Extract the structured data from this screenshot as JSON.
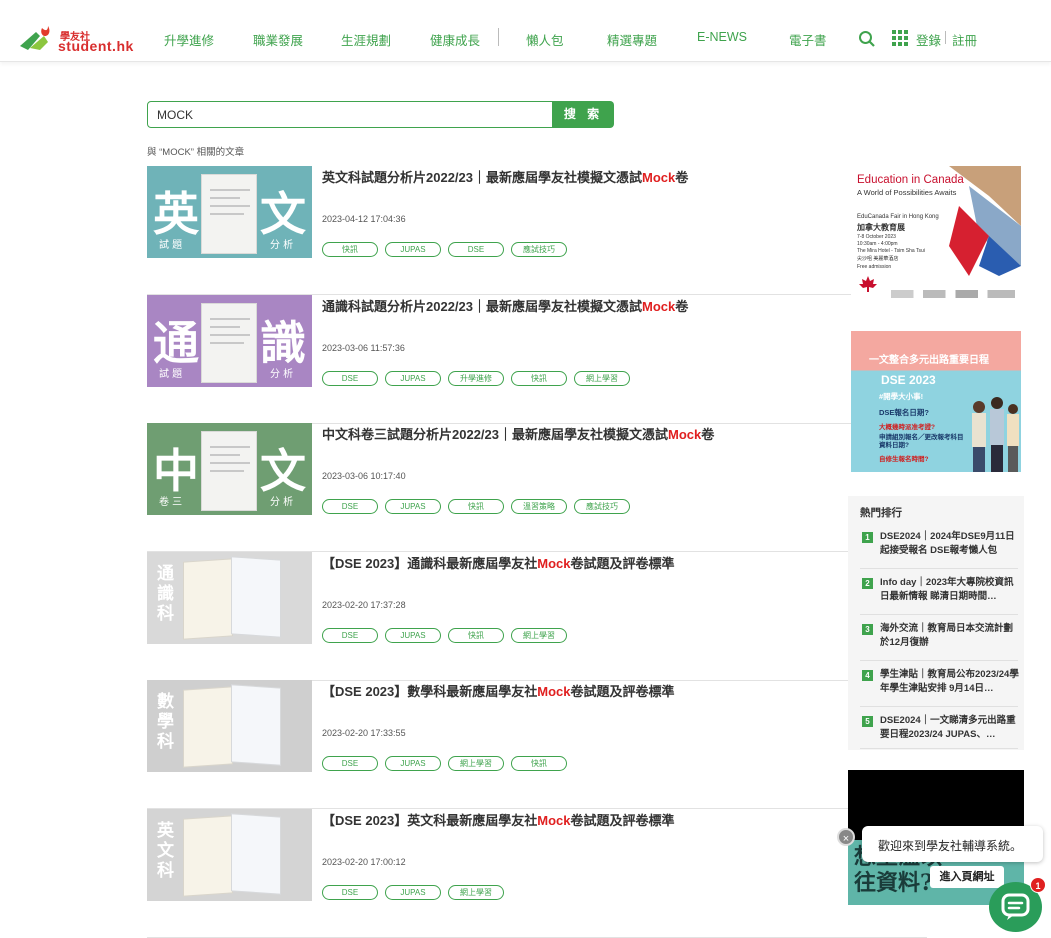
{
  "header": {
    "logo_cn": "學友社",
    "logo_en": "student.hk",
    "nav": [
      "升學進修",
      "職業發展",
      "生涯規劃",
      "健康成長",
      "懶人包",
      "精選專題",
      "E-NEWS",
      "電子書"
    ],
    "login": "登錄",
    "register": "註冊"
  },
  "search": {
    "value": "MOCK",
    "button": "搜 索",
    "result_label": "與 “MOCK” 相關的文章"
  },
  "articles": [
    {
      "title_pre": "英文科試題分析片2022/23｜最新應屆學友社模擬文憑試",
      "title_hl": "Mock",
      "title_post": "卷",
      "date": "2023-04-12 17:04:36",
      "tags": [
        "快訊",
        "JUPAS",
        "DSE",
        "應試技巧"
      ],
      "thumb_left": "英",
      "thumb_right": "文",
      "thumb_sub_left": "試 題",
      "thumb_sub_right": "分 析",
      "thumb_color": "#6fb3b8"
    },
    {
      "title_pre": "通識科試題分析片2022/23｜最新應屆學友社模擬文憑試",
      "title_hl": "Mock",
      "title_post": "卷",
      "date": "2023-03-06 11:57:36",
      "tags": [
        "DSE",
        "JUPAS",
        "升學進修",
        "快訊",
        "網上學習"
      ],
      "thumb_left": "通",
      "thumb_right": "識",
      "thumb_sub_left": "試 題",
      "thumb_sub_right": "分 析",
      "thumb_color": "#a986c3"
    },
    {
      "title_pre": "中文科卷三試題分析片2022/23｜最新應屆學友社模擬文憑試",
      "title_hl": "Mock",
      "title_post": "卷",
      "date": "2023-03-06 10:17:40",
      "tags": [
        "DSE",
        "JUPAS",
        "快訊",
        "溫習策略",
        "應試技巧"
      ],
      "thumb_left": "中",
      "thumb_right": "文",
      "thumb_sub_left": "卷 三",
      "thumb_sub_right": "分 析",
      "thumb_color": "#6f9e72"
    },
    {
      "title_pre": "【DSE 2023】通識科最新應屆學友社",
      "title_hl": "Mock",
      "title_post": "卷試題及評卷標準",
      "date": "2023-02-20 17:37:28",
      "tags": [
        "DSE",
        "JUPAS",
        "快訊",
        "網上學習"
      ],
      "thumb_vert": "通識科",
      "thumb_color": "#d9d9d9"
    },
    {
      "title_pre": "【DSE 2023】數學科最新應屆學友社",
      "title_hl": "Mock",
      "title_post": "卷試題及評卷標準",
      "date": "2023-02-20 17:33:55",
      "tags": [
        "DSE",
        "JUPAS",
        "網上學習",
        "快訊"
      ],
      "thumb_vert": "數學科",
      "thumb_color": "#cfcfcf"
    },
    {
      "title_pre": "【DSE 2023】英文科最新應屆學友社",
      "title_hl": "Mock",
      "title_post": "卷試題及評卷標準",
      "date": "2023-02-20 17:00:12",
      "tags": [
        "DSE",
        "JUPAS",
        "網上學習"
      ],
      "thumb_vert": "英文科",
      "thumb_color": "#d4d4d4"
    }
  ],
  "ad1": {
    "title": "Education in Canada",
    "subtitle": "A World of Possibilities Awaits",
    "fair": "EduCanada Fair in Hong Kong",
    "fair_cn": "加拿大教育展",
    "date": "7-8 October 2023",
    "time": "10:30am - 4:00pm",
    "venue": "The Mira Hotel - Tsim Sha Tsui",
    "venue_cn": "尖沙咀 美麗華酒店",
    "free": "Free admission"
  },
  "ad2": {
    "headline": "一文整合多元出路重要日程",
    "sub": "DSE 2023",
    "q1": "#開學大小事!",
    "q2": "DSE報名日期?",
    "q3": "大概幾時派准考證?",
    "q4": "申請組別報名／更改報考科目資料日期?",
    "q5": "自修生報名時間?"
  },
  "ranking": {
    "title": "熱門排行",
    "items": [
      {
        "num": "1",
        "text": "DSE2024｜2024年DSE9月11日起接受報名 DSE報考懶人包"
      },
      {
        "num": "2",
        "text": "Info day｜2023年大專院校資訊日最新情報 睇清日期時間…"
      },
      {
        "num": "3",
        "text": "海外交流｜教育局日本交流計劃 於12月復辦"
      },
      {
        "num": "4",
        "text": "學生津貼｜教育局公布2023/24學年學生津貼安排 9月14日…"
      },
      {
        "num": "5",
        "text": "DSE2024｜一文睇清多元出路重要日程2023/24 JUPAS、…"
      }
    ]
  },
  "video": {
    "text": "想重温以\n往資料?"
  },
  "chat": {
    "close": "×",
    "welcome": "歡迎來到學友社輔導系統。",
    "enter": "進入頁網址",
    "badge": "1"
  }
}
